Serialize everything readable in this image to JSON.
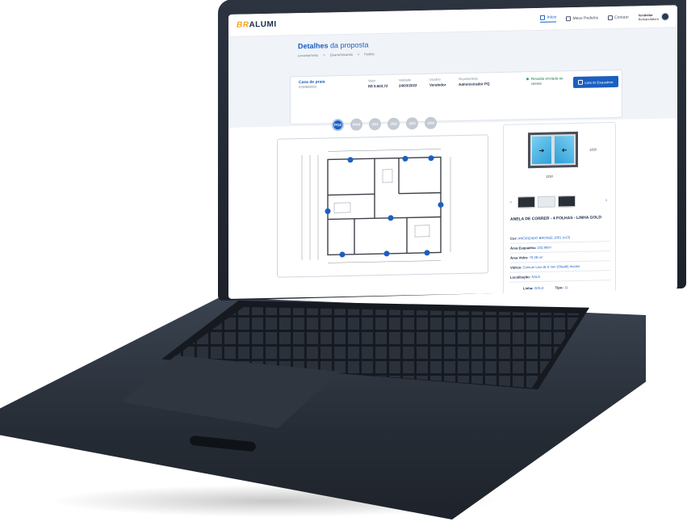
{
  "app": {
    "logo_prefix": "BR",
    "logo_suffix": "ALUMI",
    "nav": [
      {
        "label": "Início",
        "icon": "home-icon",
        "active": true
      },
      {
        "label": "Meus Pedidos",
        "icon": "orders-icon",
        "active": false
      },
      {
        "label": "Contato",
        "icon": "contact-icon",
        "active": false
      }
    ],
    "user": {
      "role": "Vendedor",
      "name": "Remanufatura"
    }
  },
  "page": {
    "title_bold": "Detalhes",
    "title_rest": " da proposta",
    "breadcrumbs": [
      "Levantamento",
      ">",
      "Quarto/Varanda",
      ">",
      "Pedido"
    ]
  },
  "proposal": {
    "client_label": "Casa de praia",
    "client_code": "0260808022",
    "value_label": "Valor",
    "value": "R$ 5.603,72",
    "validity_label": "Validade",
    "validity": "24/03/2022",
    "user_label": "Usuário",
    "user": "Vendedor",
    "estimator_label": "Orçamentista",
    "estimator": "Administrador PQ",
    "status": "Revisão enviada ao cliente",
    "list_button": "Lista de Esquadrias",
    "accent": "#1b5fc1"
  },
  "tabs": [
    "PO2",
    "PO4",
    "JO1",
    "JO2",
    "JO3",
    "JO4"
  ],
  "product": {
    "width_dim": "1250",
    "height_dim": "1250",
    "title": "ANELA DE CORRER - 4 FOLHAS - LINHA GOLD",
    "specs": [
      {
        "label": "Cor:",
        "value": "ANODIZADO BRONZE 1001 (x13)"
      },
      {
        "label": "Área Esquadria:",
        "value": "102,90m²"
      },
      {
        "label": "Área Vidro:",
        "value": "79,38 m²"
      },
      {
        "label": "Vidros:",
        "value": "Comum Liso de 6 mm (Shadé) Incolor"
      },
      {
        "label": "Localização:",
        "value": "SALA"
      }
    ],
    "line_label": "Linha:",
    "line": "GOLD",
    "type_label": "Tipo:",
    "type": "J1"
  }
}
